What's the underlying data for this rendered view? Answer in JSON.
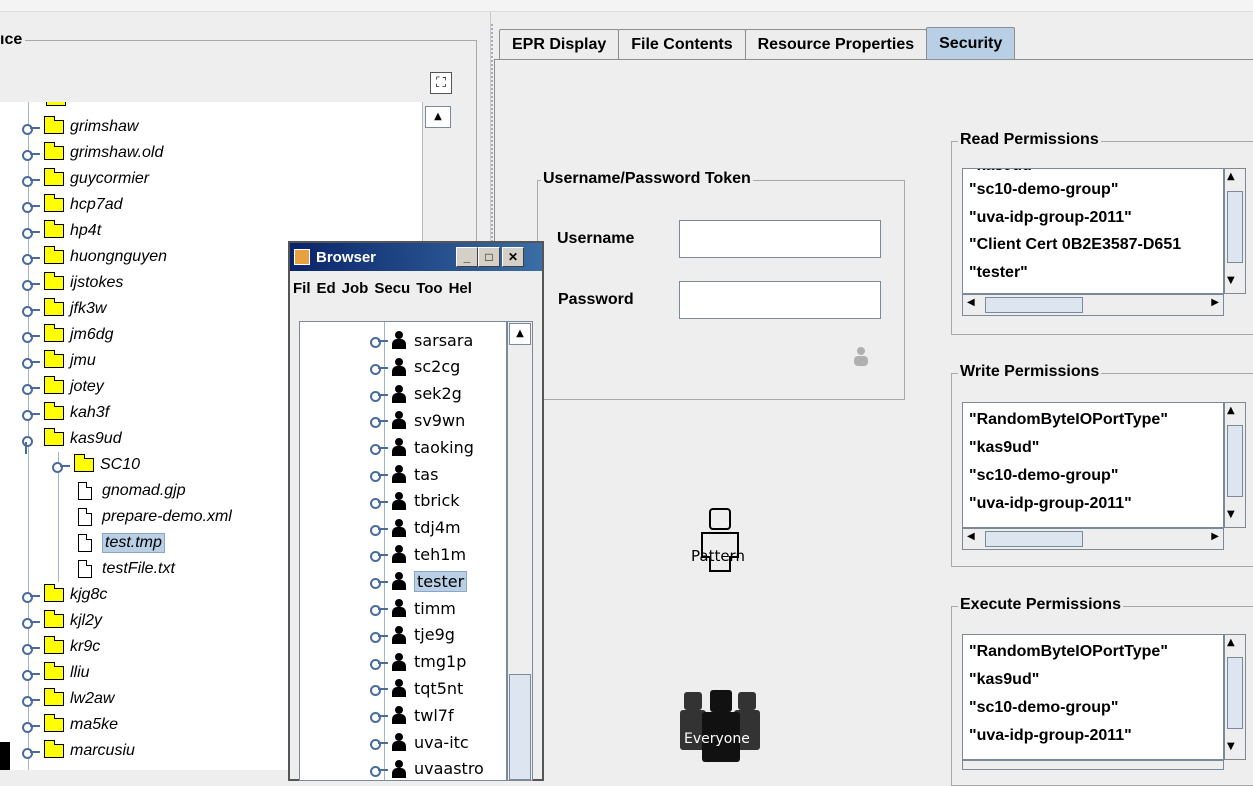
{
  "left_panel": {
    "title": "ıce",
    "collapse_icon": "collapse-icon",
    "tree": [
      {
        "label": "grimshaw",
        "kind": "folder"
      },
      {
        "label": "grimshaw.old",
        "kind": "folder"
      },
      {
        "label": "guycormier",
        "kind": "folder"
      },
      {
        "label": "hcp7ad",
        "kind": "folder"
      },
      {
        "label": "hp4t",
        "kind": "folder"
      },
      {
        "label": "huongnguyen",
        "kind": "folder"
      },
      {
        "label": "ijstokes",
        "kind": "folder"
      },
      {
        "label": "jfk3w",
        "kind": "folder"
      },
      {
        "label": "jm6dg",
        "kind": "folder"
      },
      {
        "label": "jmu",
        "kind": "folder"
      },
      {
        "label": "jotey",
        "kind": "folder"
      },
      {
        "label": "kah3f",
        "kind": "folder"
      },
      {
        "label": "kas9ud",
        "kind": "folder-open"
      },
      {
        "label": "SC10",
        "kind": "folder-child"
      },
      {
        "label": "gnomad.gjp",
        "kind": "file"
      },
      {
        "label": "prepare-demo.xml",
        "kind": "file"
      },
      {
        "label": "test.tmp",
        "kind": "file-selected"
      },
      {
        "label": "testFile.txt",
        "kind": "file"
      },
      {
        "label": "kjg8c",
        "kind": "folder"
      },
      {
        "label": "kjl2y",
        "kind": "folder"
      },
      {
        "label": "kr9c",
        "kind": "folder"
      },
      {
        "label": "lliu",
        "kind": "folder"
      },
      {
        "label": "lw2aw",
        "kind": "folder"
      },
      {
        "label": "ma5ke",
        "kind": "folder"
      },
      {
        "label": "marcusiu",
        "kind": "folder"
      }
    ]
  },
  "browser": {
    "title": "Browser",
    "menus": [
      "Fil",
      "Ed",
      "Job",
      "Secu",
      "Too",
      "Hel"
    ],
    "users": [
      "sarsara",
      "sc2cg",
      "sek2g",
      "sv9wn",
      "taoking",
      "tas",
      "tbrick",
      "tdj4m",
      "teh1m",
      "tester",
      "timm",
      "tje9g",
      "tmg1p",
      "tqt5nt",
      "twl7f",
      "uva-itc",
      "uvaastro"
    ],
    "selected_user": "tester"
  },
  "tabs": [
    {
      "label": "EPR Display",
      "active": false
    },
    {
      "label": "File Contents",
      "active": false
    },
    {
      "label": "Resource Properties",
      "active": false
    },
    {
      "label": "Security",
      "active": true
    }
  ],
  "security": {
    "token_group_title": "Username/Password Token",
    "username_label": "Username",
    "password_label": "Password",
    "username_value": "",
    "password_value": "",
    "pattern_label": "Pattern",
    "everyone_label": "Everyone",
    "read": {
      "title": "Read Permissions",
      "items": [
        "\"sc10-demo-group\"",
        "\"uva-idp-group-2011\"",
        "\"Client Cert 0B2E3587-D651",
        "\"tester\""
      ]
    },
    "write": {
      "title": "Write Permissions",
      "items": [
        "\"RandomByteIOPortType\"",
        "\"kas9ud\"",
        "\"sc10-demo-group\"",
        "\"uva-idp-group-2011\""
      ]
    },
    "execute": {
      "title": "Execute Permissions",
      "items": [
        "\"RandomByteIOPortType\"",
        "\"kas9ud\"",
        "\"sc10-demo-group\"",
        "\"uva-idp-group-2011\""
      ]
    }
  }
}
